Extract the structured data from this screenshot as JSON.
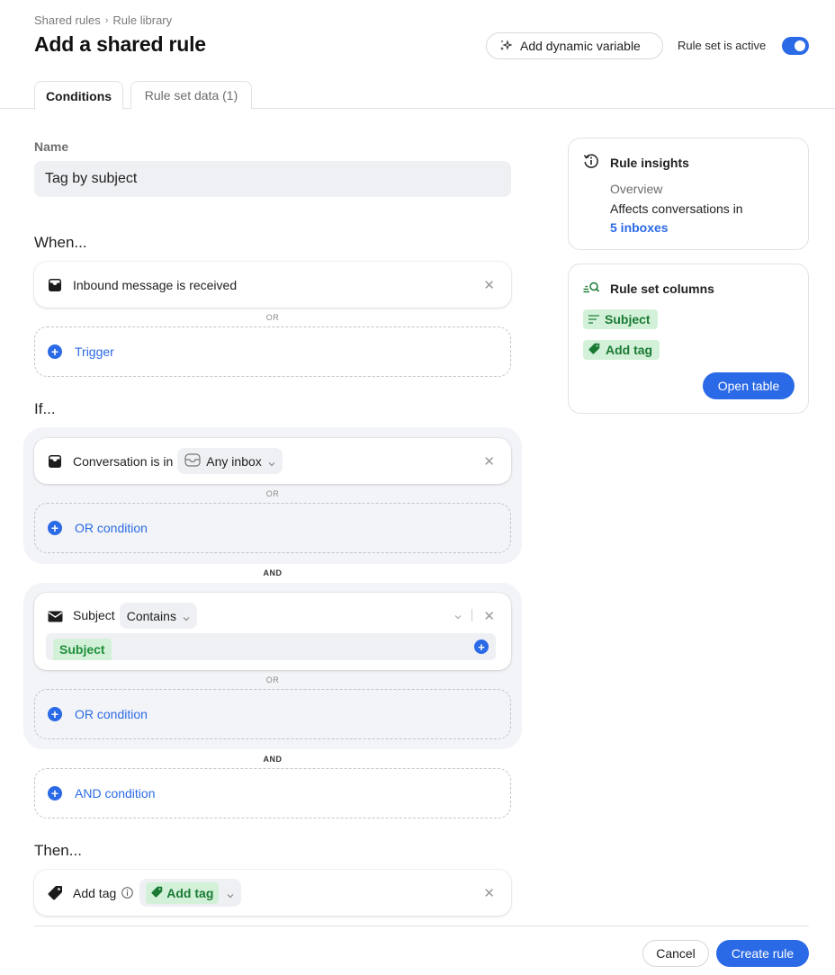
{
  "breadcrumb": [
    "Shared rules",
    "Rule library"
  ],
  "breadcrumb_separator": "›",
  "page_title": "Add a shared rule",
  "header": {
    "dynamic_variable_button": "Add dynamic variable",
    "active_toggle_label": "Rule set is active",
    "active_toggle_on": true
  },
  "tabs": [
    {
      "label": "Conditions",
      "active": true
    },
    {
      "label": "Rule set data (1)",
      "active": false
    }
  ],
  "name_field": {
    "label": "Name",
    "value": "Tag by subject"
  },
  "when": {
    "title": "When...",
    "trigger": {
      "icon": "inbox-icon",
      "label": "Inbound message is received"
    },
    "or_label": "OR",
    "add_trigger": "Trigger"
  },
  "if": {
    "title": "If...",
    "condition1": {
      "icon": "inbox-icon",
      "label": "Conversation is in",
      "select_icon": "inbox-outline-icon",
      "select_value": "Any inbox"
    },
    "or_label": "OR",
    "add_or": "OR condition",
    "and_label": "AND",
    "condition2": {
      "icon": "envelope-icon",
      "label": "Subject",
      "operator": "Contains",
      "value_tag": "Subject"
    },
    "add_or2": "OR condition",
    "and_label2": "AND",
    "add_and": "AND condition"
  },
  "then": {
    "title": "Then...",
    "action": {
      "icon": "tag-icon",
      "label": "Add tag",
      "value_tag": "Add tag"
    }
  },
  "insights": {
    "title": "Rule insights",
    "overview_label": "Overview",
    "affects_text": "Affects conversations in",
    "inboxes_link": "5 inboxes"
  },
  "columns": {
    "title": "Rule set columns",
    "items": [
      {
        "icon": "text-lines-icon",
        "label": "Subject"
      },
      {
        "icon": "tag-icon",
        "label": "Add tag"
      }
    ],
    "open_button": "Open table"
  },
  "footer": {
    "cancel": "Cancel",
    "create": "Create rule"
  },
  "colors": {
    "accent": "#2b6ae6",
    "tag_bg": "#d3f1d9",
    "tag_text": "#1a7a34"
  }
}
